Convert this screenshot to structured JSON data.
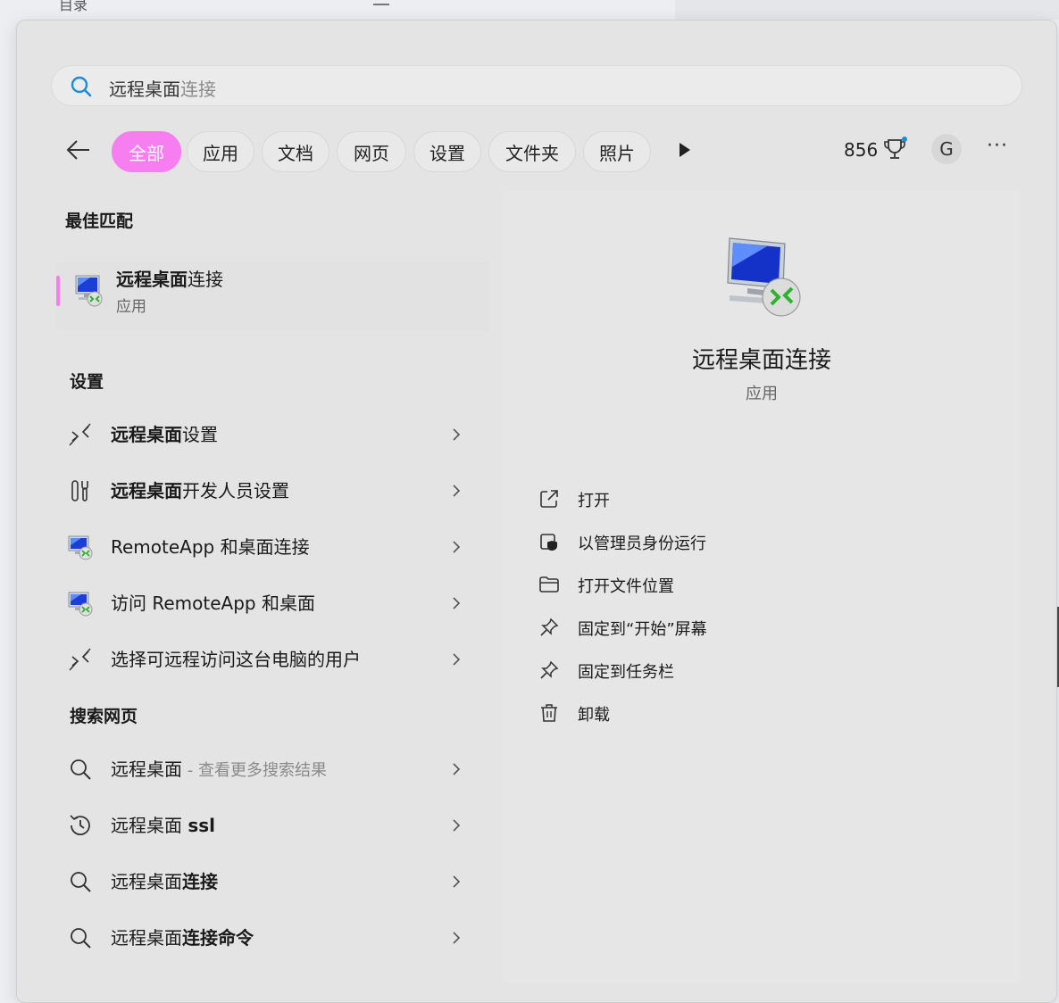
{
  "background": {
    "left_title": "目录"
  },
  "search": {
    "query_prefix": "远程桌面",
    "query_hint": "连接"
  },
  "filters": {
    "chips": [
      "全部",
      "应用",
      "文档",
      "网页",
      "设置",
      "文件夹",
      "照片"
    ],
    "active": "全部",
    "points": "856",
    "avatar": "G",
    "more": "···"
  },
  "best_match": {
    "section": "最佳匹配",
    "title_bold": "远程桌面",
    "title_rest": "连接",
    "subtitle": "应用"
  },
  "settings": {
    "section": "设置",
    "items": [
      {
        "bold": "远程桌面",
        "rest": "设置",
        "icon": "remote-arrows-icon"
      },
      {
        "bold": "远程桌面",
        "rest": "开发人员设置",
        "icon": "tools-icon"
      },
      {
        "bold": "",
        "rest": "RemoteApp 和桌面连接",
        "icon": "remote-desktop-monitor-icon"
      },
      {
        "bold": "",
        "rest": "访问 RemoteApp 和桌面",
        "icon": "remote-desktop-monitor-icon"
      },
      {
        "bold": "",
        "rest": "选择可远程访问这台电脑的用户",
        "icon": "remote-arrows-icon"
      }
    ]
  },
  "web": {
    "section": "搜索网页",
    "items": [
      {
        "prefix": "远程桌面",
        "bold": "",
        "sub": " - 查看更多搜索结果",
        "icon": "search-icon"
      },
      {
        "prefix": "远程桌面 ",
        "bold": "ssl",
        "sub": "",
        "icon": "history-icon"
      },
      {
        "prefix": "远程桌面",
        "bold": "连接",
        "sub": "",
        "icon": "search-icon"
      },
      {
        "prefix": "远程桌面",
        "bold": "连接命令",
        "sub": "",
        "icon": "search-icon"
      }
    ]
  },
  "detail": {
    "title": "远程桌面连接",
    "type": "应用",
    "actions": [
      {
        "label": "打开",
        "icon": "open-external-icon"
      },
      {
        "label": "以管理员身份运行",
        "icon": "shield-icon"
      },
      {
        "label": "打开文件位置",
        "icon": "folder-icon"
      },
      {
        "label": "固定到“开始”屏幕",
        "icon": "pin-icon"
      },
      {
        "label": "固定到任务栏",
        "icon": "pin-icon"
      },
      {
        "label": "卸载",
        "icon": "trash-icon"
      }
    ]
  },
  "colors": {
    "accent": "#f77ef0",
    "search_icon": "#1f8ad6",
    "panel": "#e4e4e4"
  }
}
